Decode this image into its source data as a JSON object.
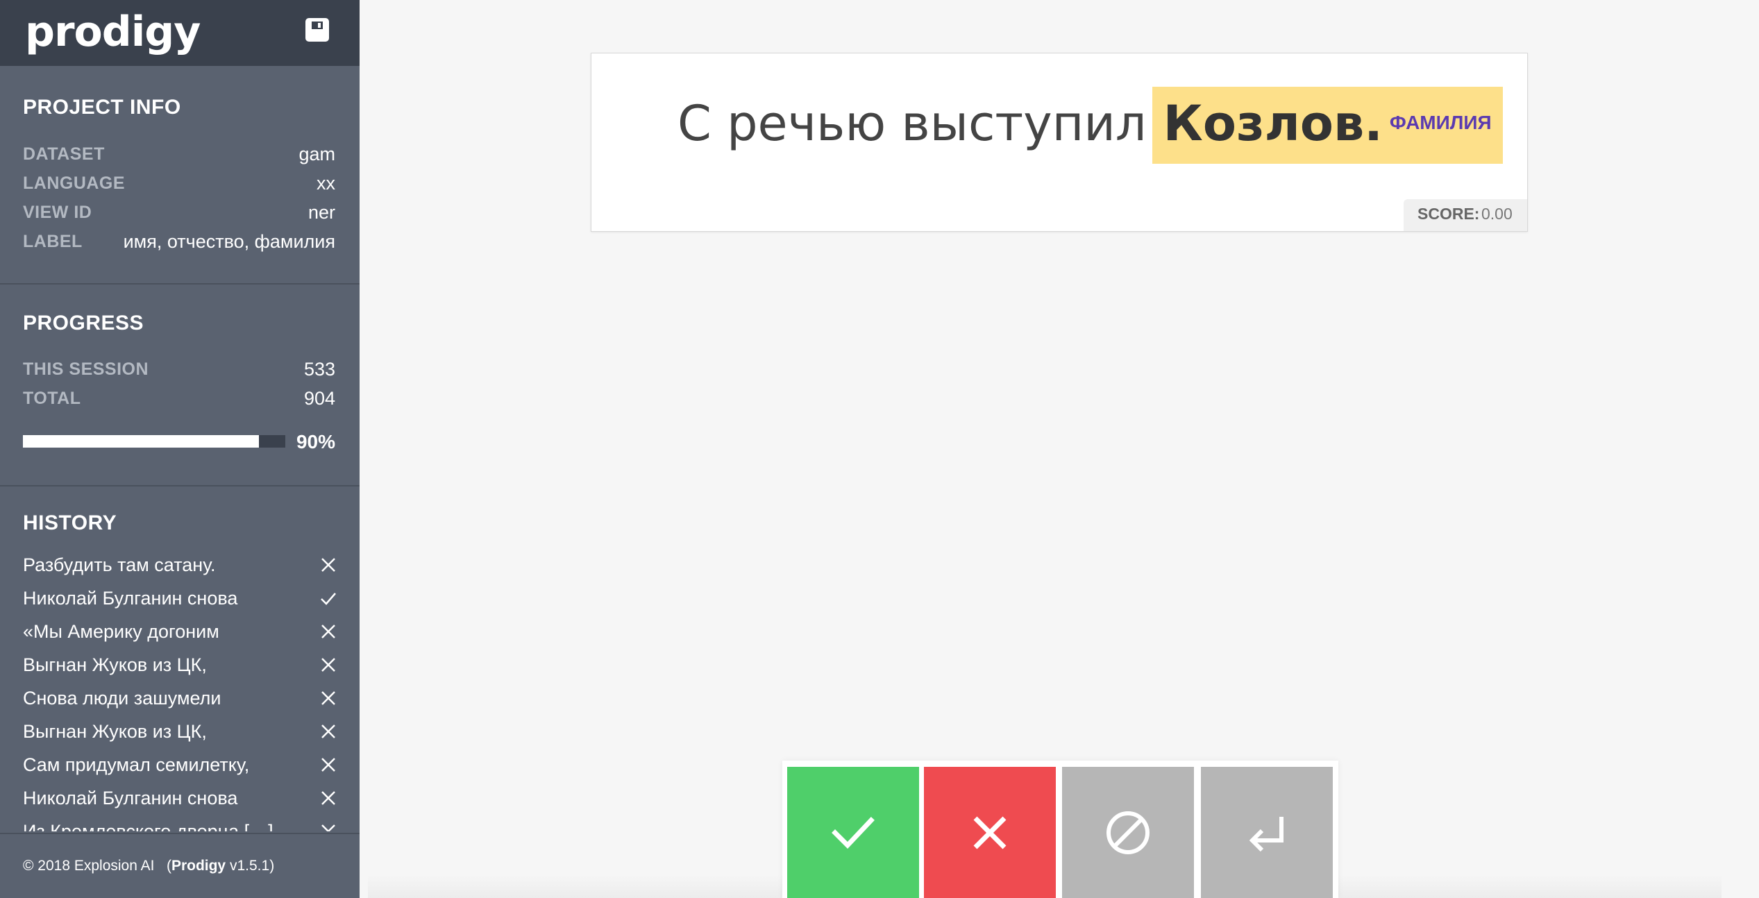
{
  "app": {
    "logo": "prodigy"
  },
  "project_info": {
    "title": "PROJECT INFO",
    "rows": [
      {
        "key": "DATASET",
        "value": "gam"
      },
      {
        "key": "LANGUAGE",
        "value": "xx"
      },
      {
        "key": "VIEW ID",
        "value": "ner"
      },
      {
        "key": "LABEL",
        "value": "имя, отчество, фамилия"
      }
    ]
  },
  "progress": {
    "title": "PROGRESS",
    "rows": [
      {
        "key": "THIS SESSION",
        "value": "533"
      },
      {
        "key": "TOTAL",
        "value": "904"
      }
    ],
    "percent_label": "90%",
    "fraction": 0.9
  },
  "history": {
    "title": "HISTORY",
    "items": [
      {
        "text": "Разбудить там сатану.",
        "status": "reject"
      },
      {
        "text": "Николай Булганин снова",
        "status": "accept"
      },
      {
        "text": "«Мы Америку догоним",
        "status": "reject"
      },
      {
        "text": "Выгнан Жуков из ЦК,",
        "status": "reject"
      },
      {
        "text": "Снова люди зашумели",
        "status": "reject"
      },
      {
        "text": "Выгнан Жуков из ЦК,",
        "status": "reject"
      },
      {
        "text": "Сам придумал семилетку,",
        "status": "reject"
      },
      {
        "text": "Николай Булганин снова",
        "status": "reject"
      },
      {
        "text": "Из Кремлевского дворца […]",
        "status": "reject"
      }
    ]
  },
  "footer": {
    "copyright": "© 2018 Explosion AI",
    "product": "Prodigy",
    "version": "v1.5.1"
  },
  "task": {
    "text": "С речью выступил",
    "entity": "Козлов.",
    "entity_label": "ФАМИЛИЯ",
    "score_label": "SCORE:",
    "score_value": "0.00"
  },
  "icons": {
    "save": "save-icon",
    "accept": "check-icon",
    "reject": "x-icon",
    "ignore": "ban-icon",
    "undo": "undo-icon"
  },
  "colors": {
    "accept": "#4fcf6a",
    "reject": "#ef4b50",
    "ignore": "#b6b6b6",
    "undo": "#b6b6b6",
    "entity_highlight": "#fde08a",
    "entity_label": "#5b3bb0",
    "sidebar": "#5a6270",
    "sidebar_header": "#3a414d"
  }
}
